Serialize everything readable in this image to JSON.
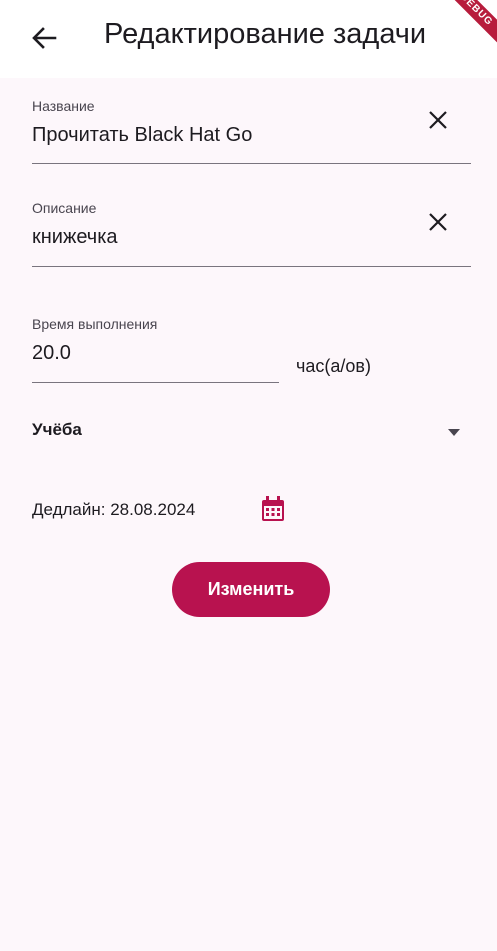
{
  "appbar": {
    "title": "Редактирование задачи",
    "back_icon": "arrow-left-icon",
    "debug_banner": "DEBUG"
  },
  "form": {
    "name": {
      "label": "Название",
      "value": "Прочитать Black Hat Go",
      "clear_icon": "close-icon"
    },
    "description": {
      "label": "Описание",
      "value": "книжечка",
      "clear_icon": "close-icon"
    },
    "duration": {
      "label": "Время выполнения",
      "value": "20.0",
      "units": "час(а/ов)"
    },
    "category": {
      "selected": "Учёба",
      "arrow_icon": "dropdown-arrow-icon"
    },
    "deadline": {
      "text": "Дедлайн: 28.08.2024",
      "calendar_icon": "calendar-icon"
    },
    "submit_label": "Изменить"
  },
  "colors": {
    "background": "#fdf7fb",
    "appbar": "#ffffff",
    "accent": "#b8124f",
    "underline": "#79747e"
  }
}
